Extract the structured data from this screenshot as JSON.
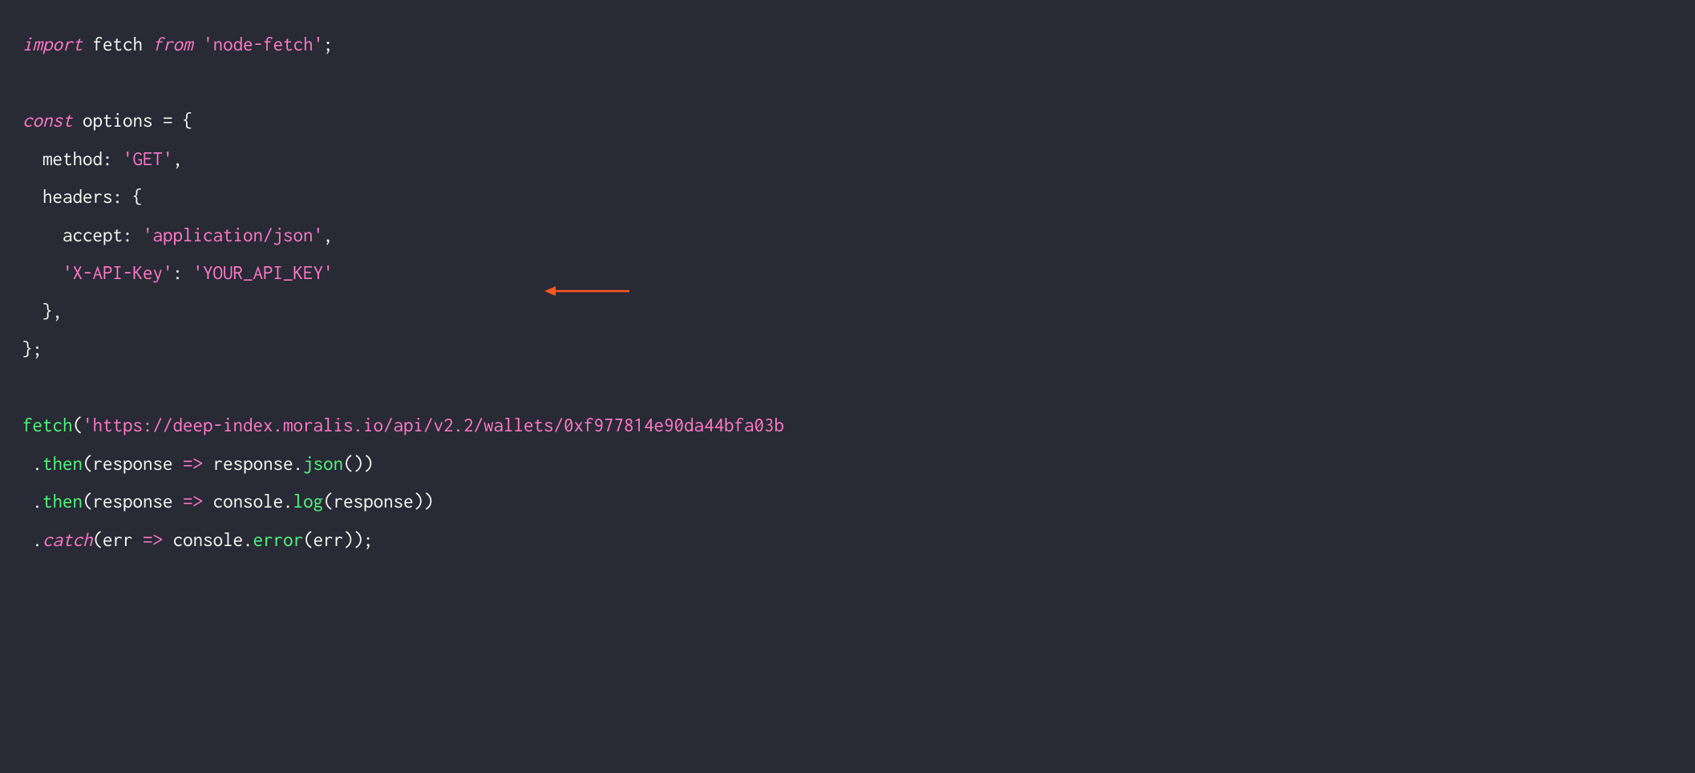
{
  "code": {
    "line1": {
      "import": "import",
      "rest": " fetch ",
      "from": "from",
      "sp1": " ",
      "str": "'node-fetch'",
      "semi": ";"
    },
    "line2": "",
    "line3": {
      "const": "const",
      "rest": " options = {"
    },
    "line4": {
      "indent": "  method: ",
      "str": "'GET'",
      "comma": ","
    },
    "line5": {
      "text": "  headers: {"
    },
    "line6": {
      "indent": "    accept: ",
      "str": "'application/json'",
      "comma": ","
    },
    "line7": {
      "indent": "    ",
      "key": "'X-API-Key'",
      "colon": ": ",
      "val": "'YOUR_API_KEY'"
    },
    "line8": {
      "text": "  },"
    },
    "line9": {
      "text": "};"
    },
    "line10": "",
    "line11": {
      "fn": "fetch",
      "open": "(",
      "url": "'https://deep-index.moralis.io/api/v2.2/wallets/0xf977814e90da44bfa03b"
    },
    "line12": {
      "indent": " .",
      "then": "then",
      "open": "(response ",
      "arrow": "=>",
      "mid": " response.",
      "json": "json",
      "close": "())"
    },
    "line13": {
      "indent": " .",
      "then": "then",
      "open": "(response ",
      "arrow": "=>",
      "mid": " console.",
      "log": "log",
      "close": "(response))"
    },
    "line14": {
      "indent": " .",
      "catch": "catch",
      "open": "(err ",
      "arrow": "=>",
      "mid": " console.",
      "error": "error",
      "close": "(err));"
    }
  }
}
